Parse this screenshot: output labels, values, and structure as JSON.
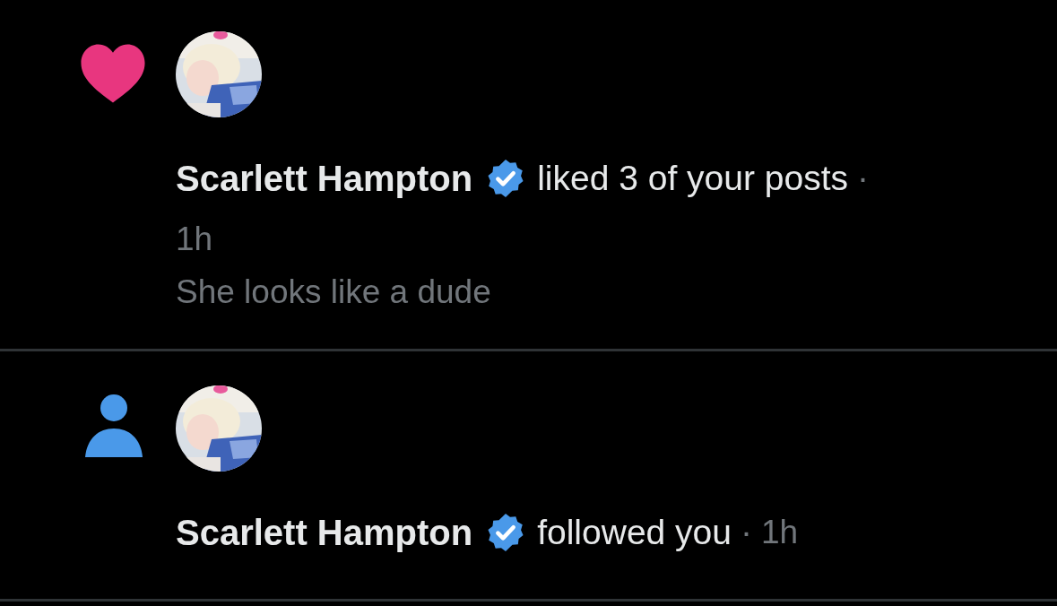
{
  "notifications": [
    {
      "kind": "like",
      "name": "Scarlett Hampton",
      "verified": true,
      "action": "liked 3 of your posts",
      "separator": "·",
      "time": "1h",
      "text": "She looks like a dude"
    },
    {
      "kind": "follow",
      "name": "Scarlett Hampton",
      "verified": true,
      "action": "followed you",
      "separator": "·",
      "time": "1h"
    }
  ]
}
